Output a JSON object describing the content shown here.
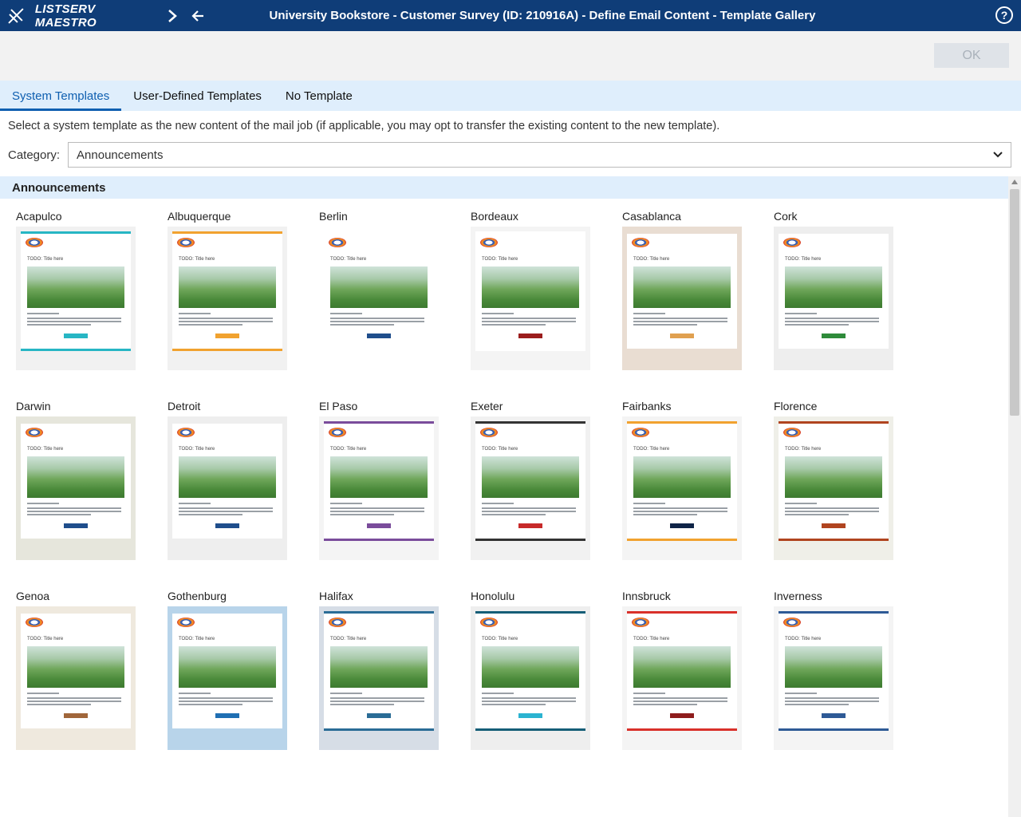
{
  "app": {
    "name": "LISTSERV MAESTRO",
    "title": "University Bookstore - Customer Survey (ID: 210916A) - Define Email Content - Template Gallery",
    "help_label": "?"
  },
  "actions": {
    "ok_label": "OK"
  },
  "tabs": [
    {
      "label": "System Templates",
      "active": true
    },
    {
      "label": "User-Defined Templates",
      "active": false
    },
    {
      "label": "No Template",
      "active": false
    }
  ],
  "instruction": "Select a system template as the new content of the mail job (if applicable, you may opt to transfer the existing content to the new template).",
  "category": {
    "label": "Category:",
    "selected": "Announcements"
  },
  "group_title": "Announcements",
  "thumb_title_text": "TODO: Title here",
  "templates": [
    {
      "name": "Acapulco",
      "accent": "#27b6c4",
      "bg": "#f1f1f1",
      "button": "#27b6c4"
    },
    {
      "name": "Albuquerque",
      "accent": "#f1a22f",
      "bg": "#f1f1f1",
      "button": "#f1a22f"
    },
    {
      "name": "Berlin",
      "accent": "#ffffff",
      "bg": "#ffffff",
      "button": "#1f4e8c"
    },
    {
      "name": "Bordeaux",
      "accent": "#ffffff",
      "bg": "#f4f4f4",
      "button": "#9b1d1d"
    },
    {
      "name": "Casablanca",
      "accent": "#e9ddd2",
      "bg": "#e9ddd2",
      "button": "#e0a050"
    },
    {
      "name": "Cork",
      "accent": "#eeeeee",
      "bg": "#eeeeee",
      "button": "#2e8b3a"
    },
    {
      "name": "Darwin",
      "accent": "#e6e6dc",
      "bg": "#e6e6dc",
      "button": "#1f4e8c"
    },
    {
      "name": "Detroit",
      "accent": "#eeeeee",
      "bg": "#eeeeee",
      "button": "#1f4e8c"
    },
    {
      "name": "El Paso",
      "accent": "#7a4c9b",
      "bg": "#f4f4f4",
      "button": "#7a4c9b"
    },
    {
      "name": "Exeter",
      "accent": "#333333",
      "bg": "#f1f1f1",
      "button": "#c72a2a"
    },
    {
      "name": "Fairbanks",
      "accent": "#f1a22f",
      "bg": "#f4f4f4",
      "button": "#0f2447"
    },
    {
      "name": "Florence",
      "accent": "#b0441f",
      "bg": "#efefe8",
      "button": "#b0441f"
    },
    {
      "name": "Genoa",
      "accent": "#efe9de",
      "bg": "#efe9de",
      "button": "#a0663a"
    },
    {
      "name": "Gothenburg",
      "accent": "#b8d4ea",
      "bg": "#b8d4ea",
      "button": "#1f6fb3"
    },
    {
      "name": "Halifax",
      "accent": "#2a6c96",
      "bg": "#d6dde6",
      "button": "#2a6c96"
    },
    {
      "name": "Honolulu",
      "accent": "#155e77",
      "bg": "#eeeeee",
      "button": "#2bb3d1"
    },
    {
      "name": "Innsbruck",
      "accent": "#d9302a",
      "bg": "#f4f4f4",
      "button": "#8e1c1c"
    },
    {
      "name": "Inverness",
      "accent": "#2e5a96",
      "bg": "#f4f4f4",
      "button": "#2e5a96"
    }
  ]
}
